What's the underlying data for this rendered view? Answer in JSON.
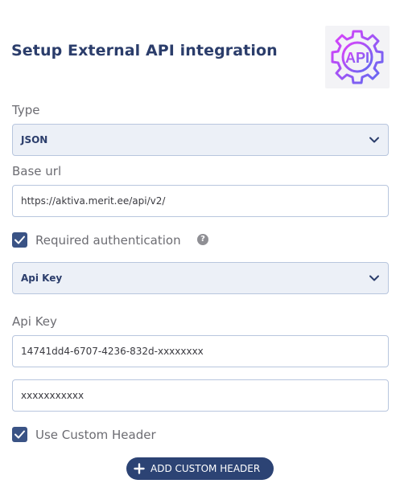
{
  "header": {
    "title": "Setup External API integration",
    "logo_icon": "api-gear-icon",
    "logo_text": "API"
  },
  "form": {
    "type_label": "Type",
    "type_value": "JSON",
    "base_url_label": "Base url",
    "base_url_value": "https://aktiva.merit.ee/api/v2/",
    "required_auth_label": "Required authentication",
    "required_auth_checked": true,
    "help_glyph": "?",
    "auth_type_value": "Api Key",
    "api_key_label": "Api Key",
    "api_key_value": "14741dd4-6707-4236-832d-xxxxxxxx",
    "secret_value": "xxxxxxxxxxx",
    "use_custom_header_label": "Use Custom Header",
    "use_custom_header_checked": true,
    "add_custom_header_label": "ADD CUSTOM HEADER"
  },
  "colors": {
    "accent": "#2c4374",
    "title": "#2b3d6b",
    "select_bg": "#ecf0f7",
    "field_border": "#b8c6de",
    "logo_gradient_start": "#e040fb",
    "logo_gradient_end": "#5c6bf0"
  }
}
